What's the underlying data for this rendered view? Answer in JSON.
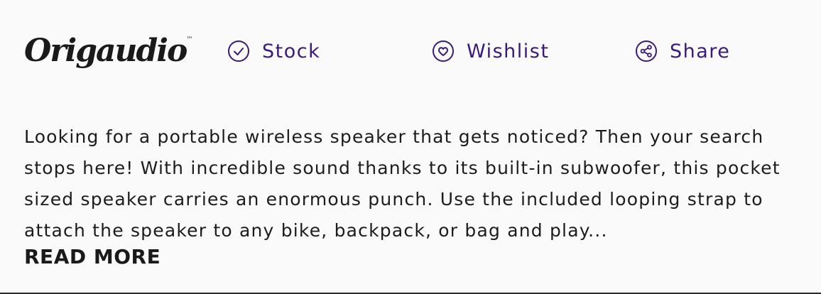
{
  "brand": {
    "logo_text": "Origaudio",
    "trademark": "™"
  },
  "actions": {
    "stock": {
      "label": "Stock",
      "icon": "check-circle-icon"
    },
    "wishlist": {
      "label": "Wishlist",
      "icon": "heart-circle-icon"
    },
    "share": {
      "label": "Share",
      "icon": "share-circle-icon"
    }
  },
  "description": {
    "lines": [
      "Looking for a portable wireless speaker that gets noticed? Then your search",
      "stops here! With incredible sound thanks to its built-in subwoofer, this pocket",
      "sized speaker carries an enormous punch. Use the included looping strap to",
      "attach the speaker to any bike, backpack, or bag and play..."
    ],
    "read_more": "READ MORE"
  },
  "colors": {
    "accent": "#3a1a7a",
    "text": "#1c1c1c",
    "background": "#fafafa"
  }
}
